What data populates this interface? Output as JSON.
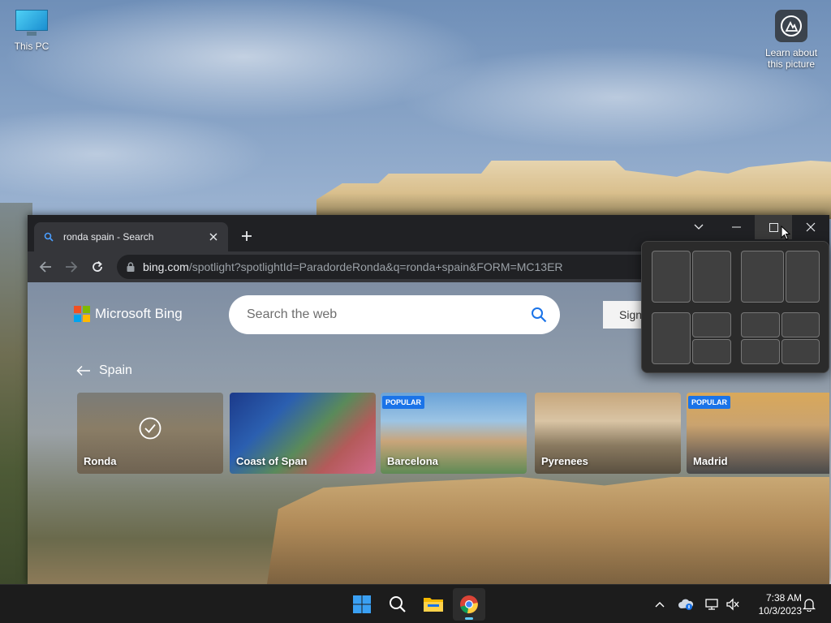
{
  "desktop": {
    "icons": [
      {
        "label": "This PC"
      },
      {
        "label": "Learn about this picture"
      }
    ]
  },
  "browser": {
    "tab": {
      "title": "ronda spain - Search"
    },
    "address": {
      "domain": "bing.com",
      "path": "/spotlight?spotlightId=ParadordeRonda&q=ronda+spain&FORM=MC13ER"
    }
  },
  "bing": {
    "logo_text": "Microsoft Bing",
    "search_placeholder": "Search the web",
    "signin_label": "Sign",
    "back_label": "Spain",
    "cards": [
      {
        "name": "Ronda",
        "badge": "",
        "selected": true
      },
      {
        "name": "Coast of Span",
        "badge": "",
        "selected": false
      },
      {
        "name": "Barcelona",
        "badge": "POPULAR",
        "selected": false
      },
      {
        "name": "Pyrenees",
        "badge": "",
        "selected": false
      },
      {
        "name": "Madrid",
        "badge": "POPULAR",
        "selected": false
      }
    ]
  },
  "snap_layouts": {
    "options": [
      "two-halves",
      "two-thirds-left",
      "main-plus-two-stacked",
      "four-quadrants"
    ]
  },
  "taskbar": {
    "apps": [
      "start",
      "search",
      "file-explorer",
      "chrome"
    ],
    "clock": {
      "time": "7:38 AM",
      "date": "10/3/2023"
    }
  }
}
